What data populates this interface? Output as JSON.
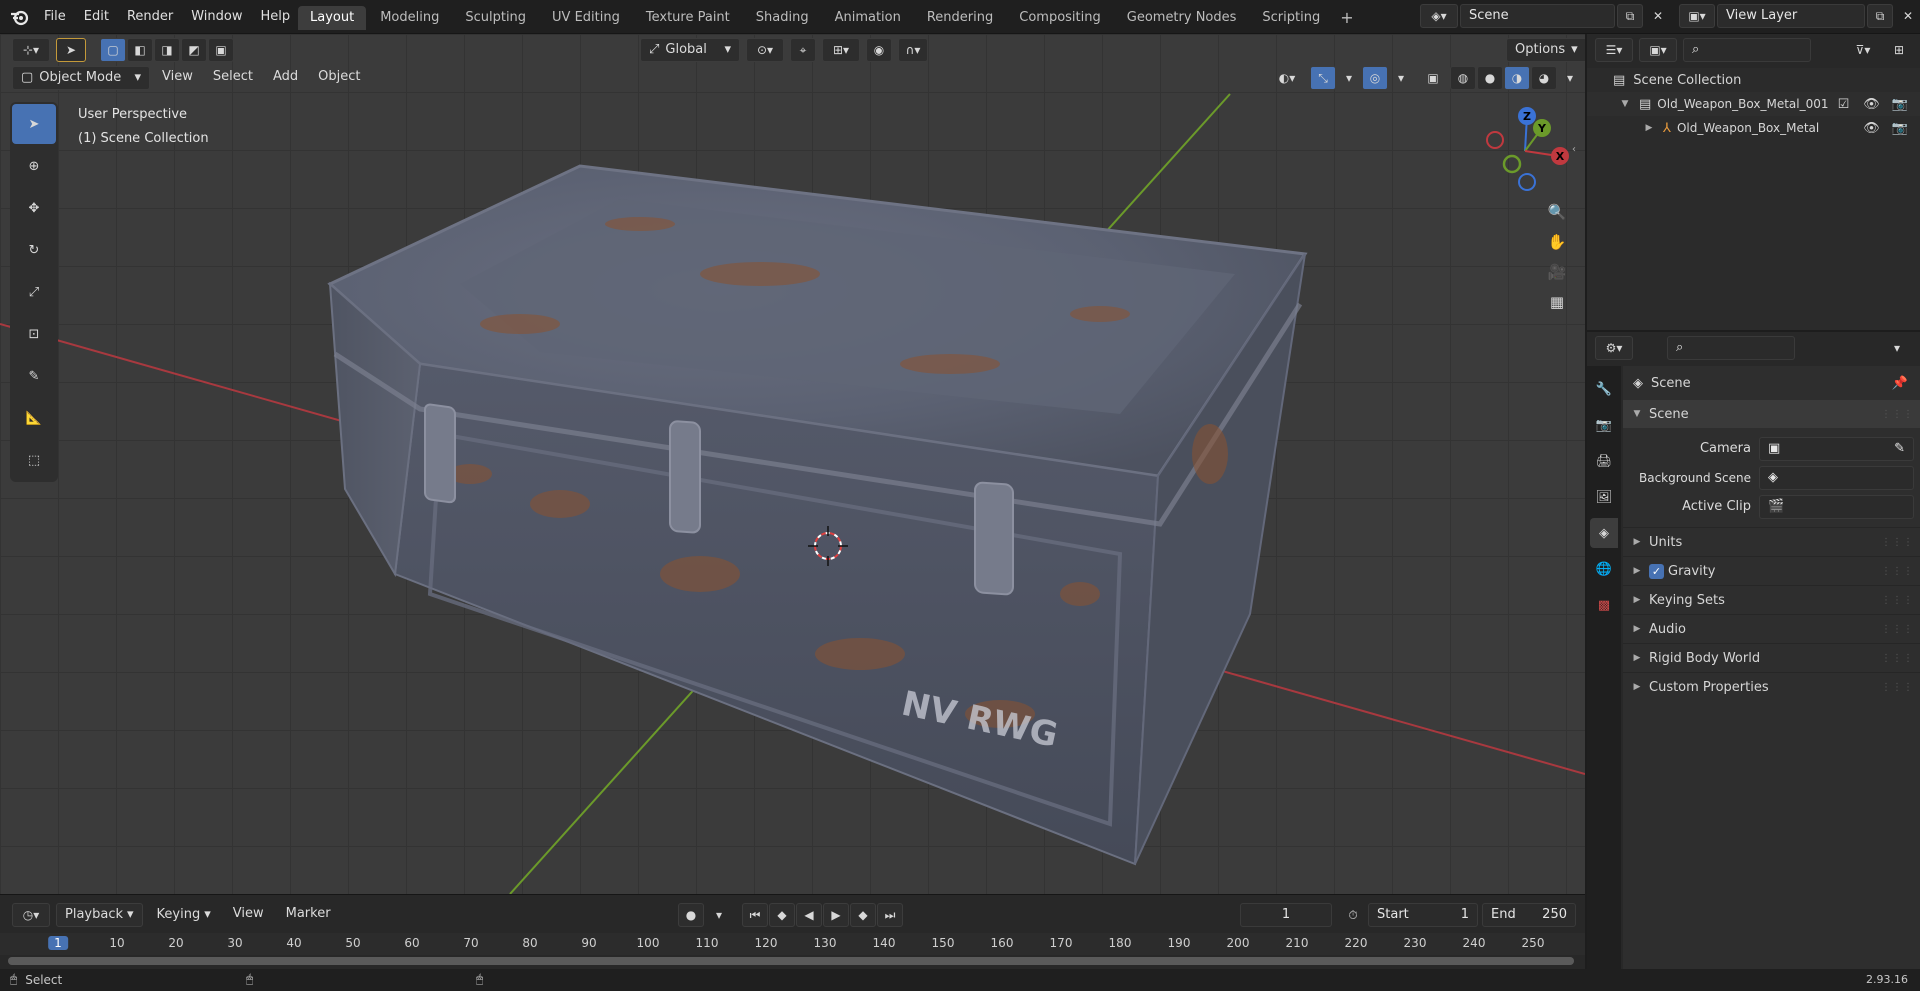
{
  "menu": [
    "File",
    "Edit",
    "Render",
    "Window",
    "Help"
  ],
  "workspaces": [
    "Layout",
    "Modeling",
    "Sculpting",
    "UV Editing",
    "Texture Paint",
    "Shading",
    "Animation",
    "Rendering",
    "Compositing",
    "Geometry Nodes",
    "Scripting"
  ],
  "active_workspace": "Layout",
  "scene_field": "Scene",
  "view_layer_field": "View Layer",
  "viewport": {
    "transform_orientation": "Global",
    "options_label": "Options",
    "mode": "Object Mode",
    "menus": [
      "View",
      "Select",
      "Add",
      "Object"
    ],
    "overlay_title": "User Perspective",
    "overlay_collection": "(1) Scene Collection",
    "crate_stencil": "NV RWG",
    "gizmo": {
      "x": "X",
      "y": "Y",
      "z": "Z"
    }
  },
  "timeline": {
    "menus": [
      "Playback",
      "Keying",
      "View",
      "Marker"
    ],
    "current_frame": "1",
    "start_label": "Start",
    "start_value": "1",
    "end_label": "End",
    "end_value": "250",
    "ruler": [
      "1",
      "10",
      "20",
      "30",
      "40",
      "50",
      "60",
      "70",
      "80",
      "90",
      "100",
      "110",
      "120",
      "130",
      "140",
      "150",
      "160",
      "170",
      "180",
      "190",
      "200",
      "210",
      "220",
      "230",
      "240",
      "250"
    ]
  },
  "status": {
    "left": "Select",
    "version": "2.93.16"
  },
  "outliner": {
    "root": "Scene Collection",
    "items": [
      {
        "label": "Old_Weapon_Box_Metal_001",
        "level": 1
      },
      {
        "label": "Old_Weapon_Box_Metal",
        "level": 2
      }
    ]
  },
  "properties": {
    "context": "Scene",
    "panel_title": "Scene",
    "fields": [
      {
        "label": "Camera"
      },
      {
        "label": "Background Scene"
      },
      {
        "label": "Active Clip"
      }
    ],
    "sections": [
      "Units",
      "Gravity",
      "Keying Sets",
      "Audio",
      "Rigid Body World",
      "Custom Properties"
    ],
    "gravity_checked": true
  },
  "colors": {
    "accent": "#4772b3",
    "x_axis": "#a8393f",
    "y_axis": "#6b9a2a",
    "rust": "#8a5230",
    "steel": "#5d6577"
  }
}
